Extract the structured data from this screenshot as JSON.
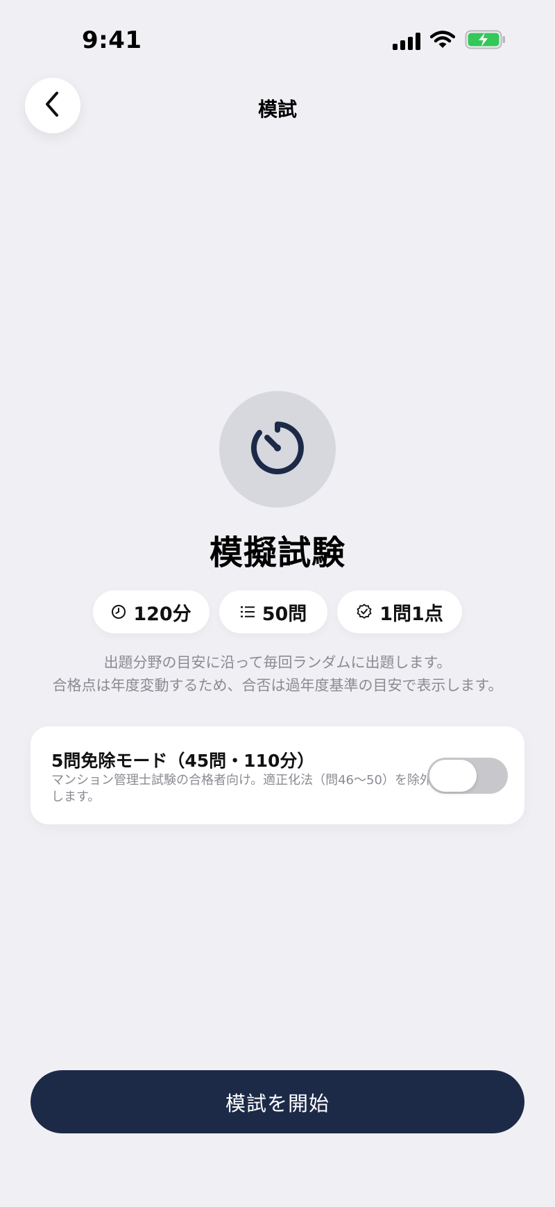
{
  "status_bar": {
    "time": "9:41",
    "battery_color": "#34c759"
  },
  "nav": {
    "title": "模試",
    "back_icon": "chevron-left-icon"
  },
  "hero": {
    "icon": "timer-icon",
    "title": "模擬試験",
    "icon_color": "#1c2a48"
  },
  "pills": [
    {
      "icon": "clock-icon",
      "label": "120分"
    },
    {
      "icon": "list-icon",
      "label": "50問"
    },
    {
      "icon": "badge-check-icon",
      "label": "1問1点"
    }
  ],
  "description": {
    "line1": "出題分野の目安に沿って毎回ランダムに出題します。",
    "line2": "合格点は年度変動するため、合否は過年度基準の目安で表示します。"
  },
  "mode_option": {
    "title": "5問免除モード（45問・110分）",
    "description": "マンション管理士試験の合格者向け。適正化法（問46〜50）を除外します。",
    "toggle_on": false
  },
  "start_button": {
    "label": "模試を開始",
    "color": "#1c2a48"
  }
}
